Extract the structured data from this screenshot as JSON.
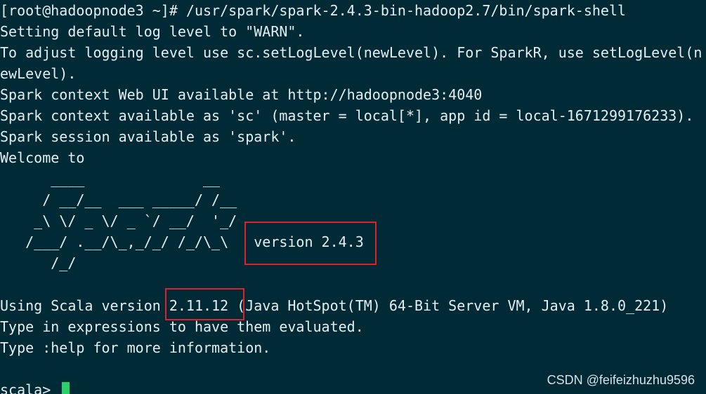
{
  "terminal": {
    "background": "#002b36",
    "foreground": "#e6edf0",
    "lines": [
      "[root@hadoopnode3 ~]# /usr/spark/spark-2.4.3-bin-hadoop2.7/bin/spark-shell",
      "Setting default log level to \"WARN\".",
      "To adjust logging level use sc.setLogLevel(newLevel). For SparkR, use setLogLevel(n",
      "ewLevel).",
      "Spark context Web UI available at http://hadoopnode3:4040",
      "Spark context available as 'sc' (master = local[*], app id = local-1671299176233).",
      "Spark session available as 'spark'.",
      "Welcome to",
      "      ____              __",
      "     / __/__  ___ _____/ /__",
      "    _\\ \\/ _ \\/ _ `/ __/  '_/",
      "   /___/ .__/\\_,_/_/ /_/\\_\\   version 2.4.3",
      "      /_/",
      "Using Scala version 2.11.12 (Java HotSpot(TM) 64-Bit Server VM, Java 1.8.0_221)",
      "Type in expressions to have them evaluated.",
      "Type :help for more information.",
      "scala> "
    ],
    "cursor_color": "#2bd06b"
  },
  "annotations": {
    "box_color": "#e0202a"
  },
  "watermark": "CSDN @feifeizhuzhu9596"
}
